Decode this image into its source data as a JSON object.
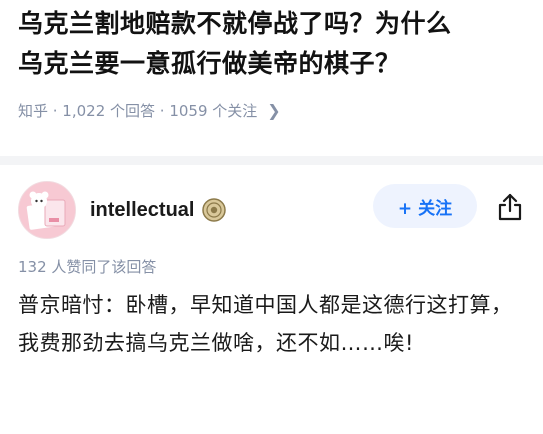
{
  "question": {
    "title_line1": "乌克兰割地赔款不就停战了吗？为什么",
    "title_line2": "乌克兰要一意孤行做美帝的棋子？",
    "meta": "知乎 · 1,022 个回答 · 1059 个关注"
  },
  "answer": {
    "author_name": "intellectual",
    "follow_label": "+ 关注",
    "agree_text": "132 人赞同了该回答",
    "content": "普京暗忖：卧槽，早知道中国人都是这德行这打算，我费那劲去搞乌克兰做啥，还不如……唉!"
  },
  "icons": {
    "meta_more": "chevron-right-icon",
    "badge": "badge-icon",
    "share": "share-icon"
  },
  "colors": {
    "accent": "#1772f6",
    "follow_bg": "#eef3fe",
    "meta_gray": "#8590a6",
    "divider": "#f3f4f6",
    "avatar_bg": "#f7c9d3"
  }
}
